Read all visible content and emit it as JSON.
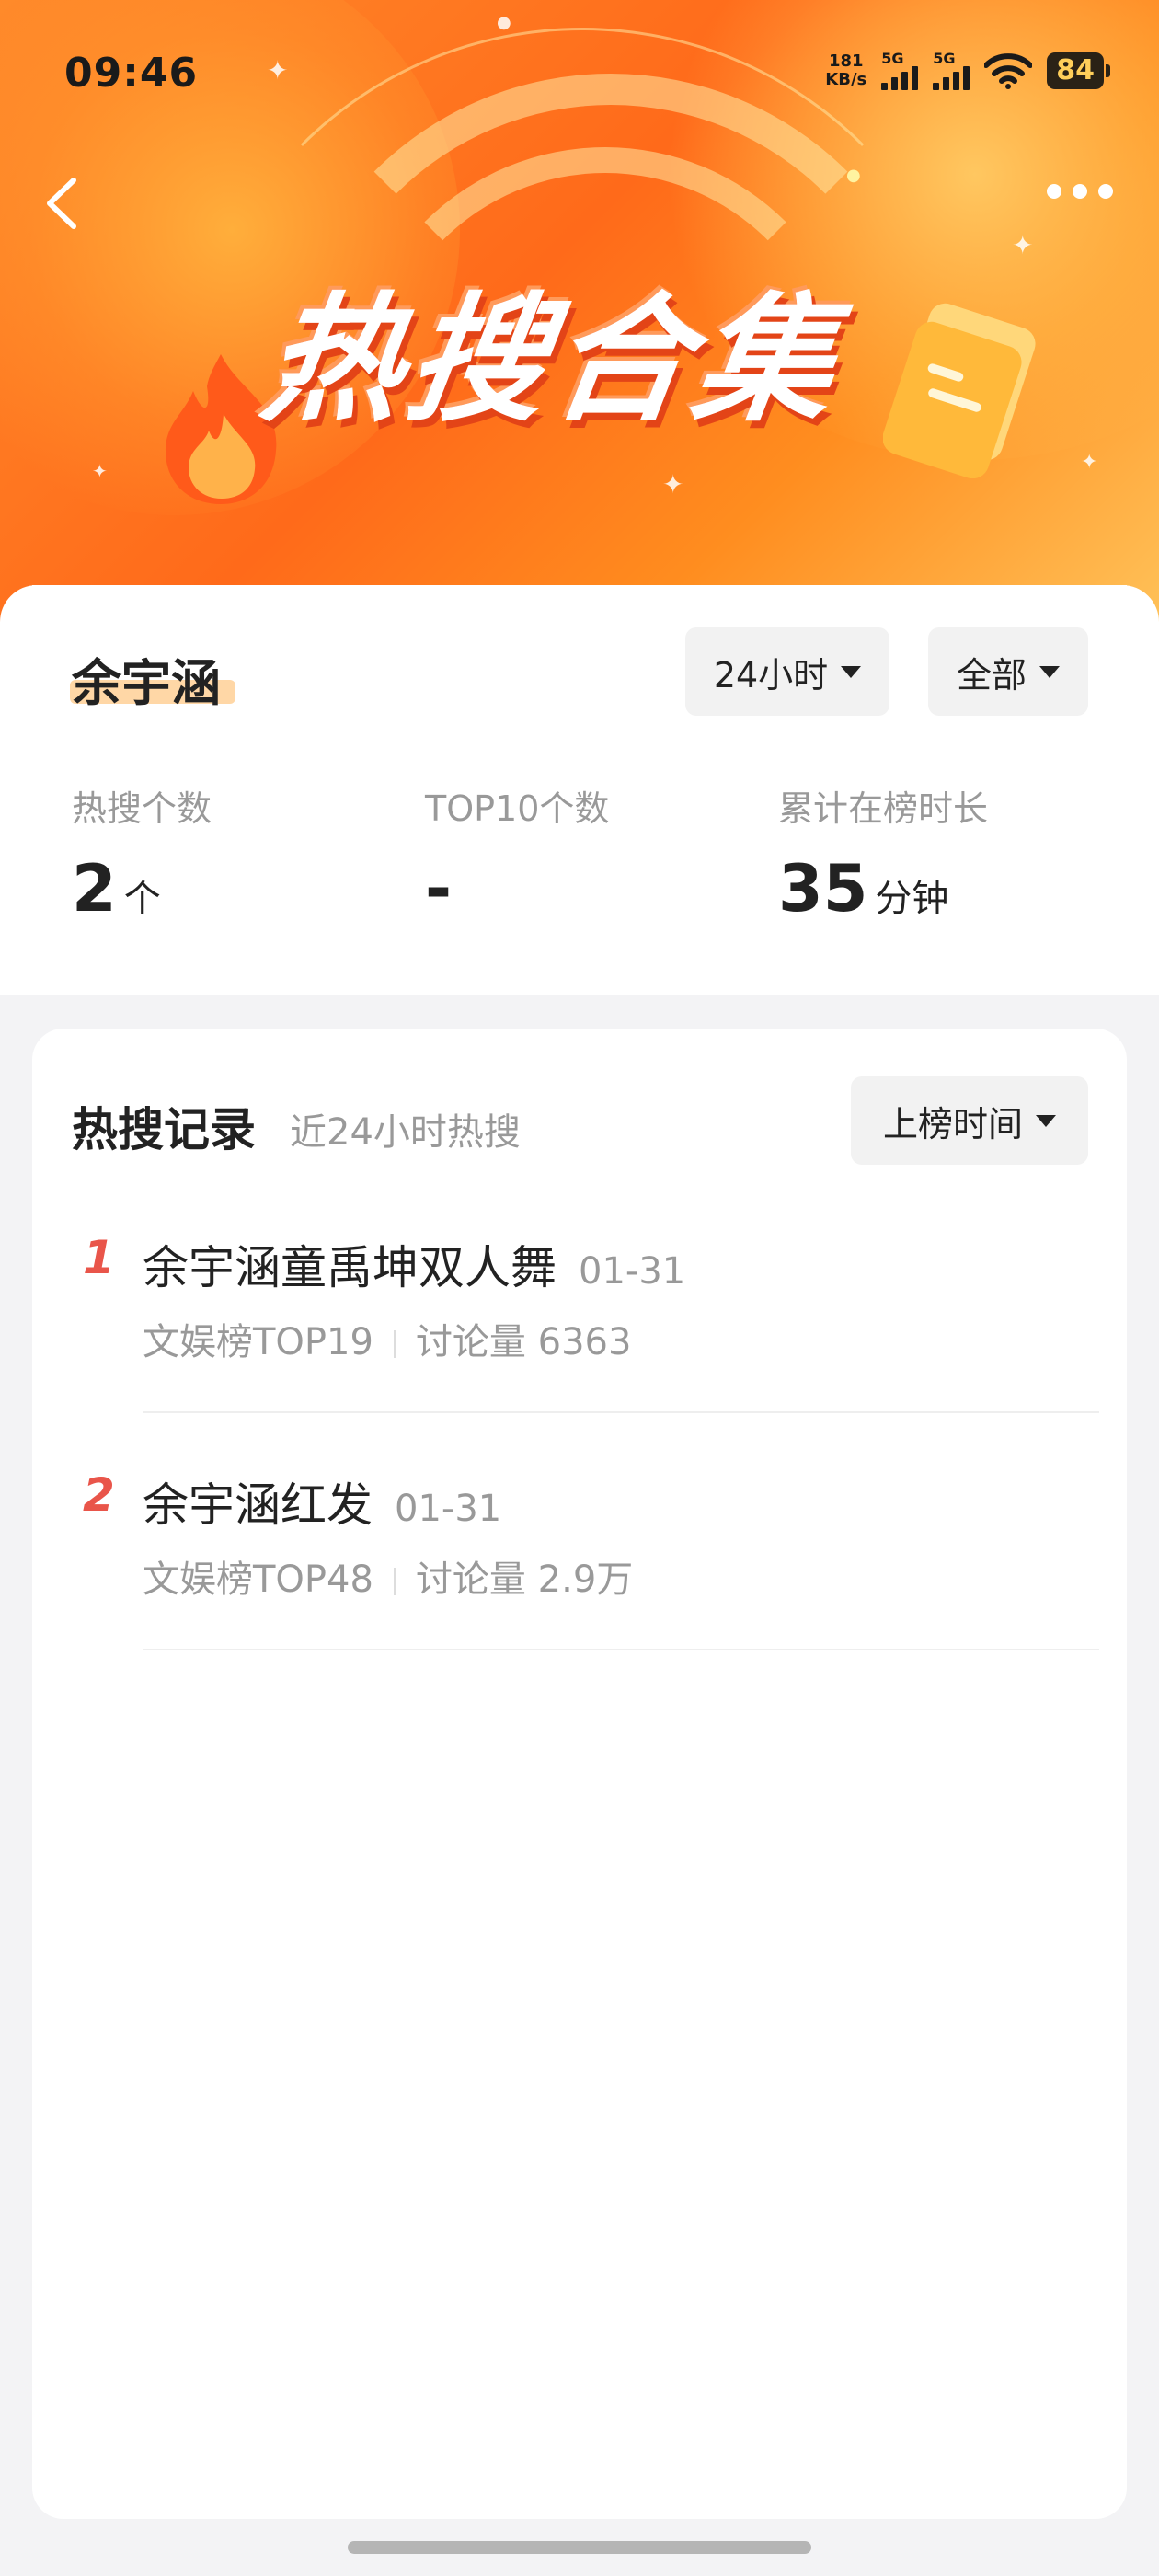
{
  "status_bar": {
    "time": "09:46",
    "net_speed_value": "181",
    "net_speed_unit": "KB/s",
    "sim1": "5G",
    "sim2": "5G",
    "battery": "84"
  },
  "header": {
    "banner_title": "热搜合集"
  },
  "profile": {
    "name": "余宇涵",
    "time_filter": "24小时",
    "scope_filter": "全部"
  },
  "stats": [
    {
      "label": "热搜个数",
      "value": "2",
      "unit": "个"
    },
    {
      "label": "TOP10个数",
      "value": "-",
      "unit": ""
    },
    {
      "label": "累计在榜时长",
      "value": "35",
      "unit": "分钟"
    }
  ],
  "records": {
    "title": "热搜记录",
    "subtitle": "近24小时热搜",
    "sort_label": "上榜时间",
    "items": [
      {
        "rank": "1",
        "title": "余宇涵童禹坤双人舞",
        "date": "01-31",
        "board": "文娱榜TOP19",
        "discussion": "讨论量 6363"
      },
      {
        "rank": "2",
        "title": "余宇涵红发",
        "date": "01-31",
        "board": "文娱榜TOP48",
        "discussion": "讨论量 2.9万"
      }
    ]
  }
}
